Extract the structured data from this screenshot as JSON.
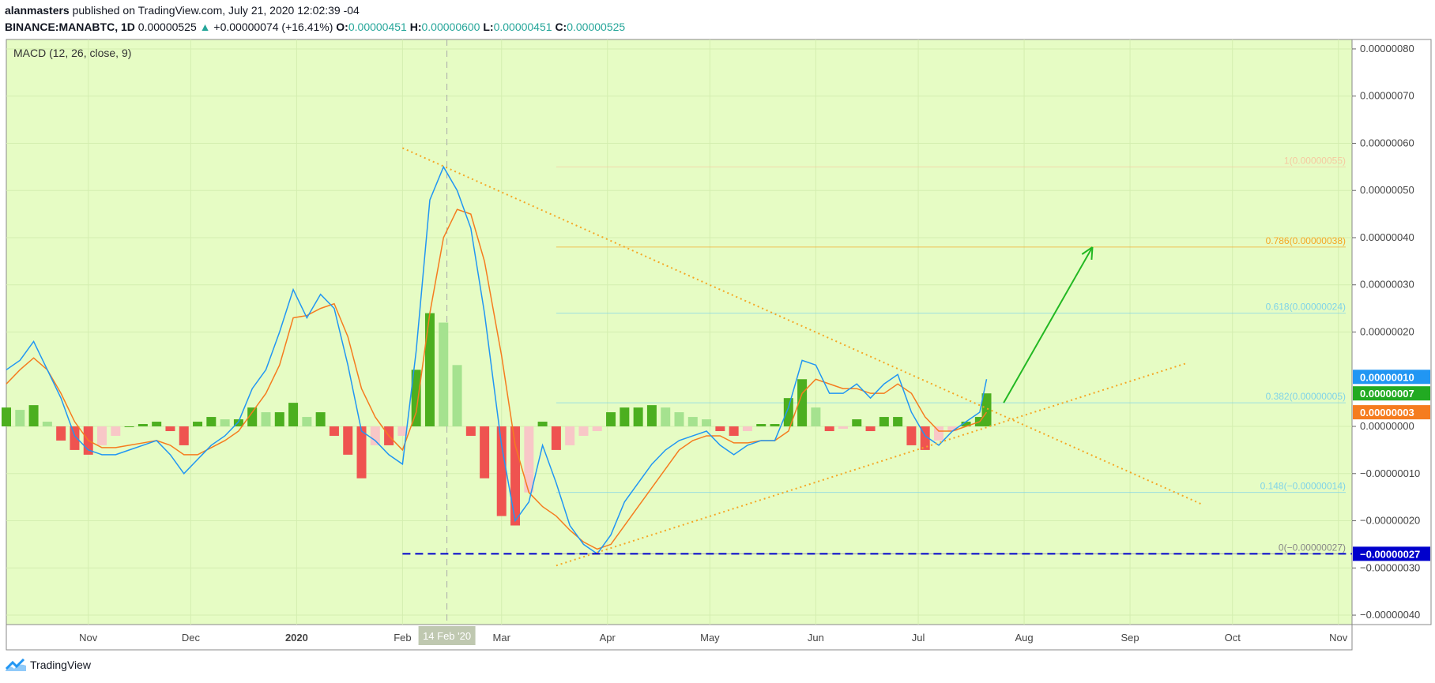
{
  "header": {
    "author": "alanmasters",
    "published": " published on TradingView.com, July 21, 2020 12:02:39 -04",
    "symbol": "BINANCE:MANABTC, 1D",
    "last": "0.00000525",
    "arrow": "▲",
    "change": "+0.00000074 (+16.41%)",
    "o_label": "O:",
    "o": "0.00000451",
    "h_label": "H:",
    "h": "0.00000600",
    "l_label": "L:",
    "l": "0.00000451",
    "c_label": "C:",
    "c": "0.00000525"
  },
  "footer": {
    "brand": "TradingView"
  },
  "chart_data": {
    "type": "line",
    "title": "MACD (12, 26, close, 9)",
    "background": "#e6fcc4",
    "ylim": [
      -4.2e-07,
      8.2e-07
    ],
    "y_ticks": [
      {
        "v": 8e-07,
        "label": "0.00000080"
      },
      {
        "v": 7e-07,
        "label": "0.00000070"
      },
      {
        "v": 6e-07,
        "label": "0.00000060"
      },
      {
        "v": 5e-07,
        "label": "0.00000050"
      },
      {
        "v": 4e-07,
        "label": "0.00000040"
      },
      {
        "v": 3e-07,
        "label": "0.00000030"
      },
      {
        "v": 2e-07,
        "label": "0.00000020"
      },
      {
        "v": 0.0,
        "label": "0.00000000"
      },
      {
        "v": -1e-07,
        "label": "−0.00000010"
      },
      {
        "v": -2e-07,
        "label": "−0.00000020"
      },
      {
        "v": -3e-07,
        "label": "−0.00000030"
      },
      {
        "v": -4e-07,
        "label": "−0.00000040"
      }
    ],
    "x_range": [
      "2019-10-08",
      "2020-11-05"
    ],
    "x_ticks": [
      {
        "date": "2019-11-01",
        "label": "Nov",
        "bold": false
      },
      {
        "date": "2019-12-01",
        "label": "Dec",
        "bold": false
      },
      {
        "date": "2020-01-01",
        "label": "2020",
        "bold": true
      },
      {
        "date": "2020-02-01",
        "label": "Feb",
        "bold": false
      },
      {
        "date": "2020-03-01",
        "label": "Mar",
        "bold": false
      },
      {
        "date": "2020-04-01",
        "label": "Apr",
        "bold": false
      },
      {
        "date": "2020-05-01",
        "label": "May",
        "bold": false
      },
      {
        "date": "2020-06-01",
        "label": "Jun",
        "bold": false
      },
      {
        "date": "2020-07-01",
        "label": "Jul",
        "bold": false
      },
      {
        "date": "2020-08-01",
        "label": "Aug",
        "bold": false
      },
      {
        "date": "2020-09-01",
        "label": "Sep",
        "bold": false
      },
      {
        "date": "2020-10-01",
        "label": "Oct",
        "bold": false
      },
      {
        "date": "2020-11-01",
        "label": "Nov",
        "bold": false
      }
    ],
    "crosshair": {
      "date": "2020-02-14",
      "label": "14 Feb '20"
    },
    "colors": {
      "macd": "#2196f3",
      "signal": "#f57c1f",
      "hist_up_strong": "#4caf1f",
      "hist_up_weak": "#a5e28f",
      "hist_down_strong": "#ef5350",
      "hist_down_weak": "#f8c7c7",
      "trendline": "#f5a623",
      "arrow": "#22b822",
      "support": "#0000cc"
    },
    "series": [
      {
        "name": "MACD",
        "points": [
          [
            "2019-10-08",
            1.2e-07
          ],
          [
            "2019-10-12",
            1.4e-07
          ],
          [
            "2019-10-16",
            1.8e-07
          ],
          [
            "2019-10-20",
            1.2e-07
          ],
          [
            "2019-10-24",
            6e-08
          ],
          [
            "2019-10-28",
            -2e-08
          ],
          [
            "2019-11-01",
            -5e-08
          ],
          [
            "2019-11-05",
            -6e-08
          ],
          [
            "2019-11-09",
            -6e-08
          ],
          [
            "2019-11-13",
            -5e-08
          ],
          [
            "2019-11-17",
            -4e-08
          ],
          [
            "2019-11-21",
            -3e-08
          ],
          [
            "2019-11-25",
            -6e-08
          ],
          [
            "2019-11-29",
            -1e-07
          ],
          [
            "2019-12-03",
            -7e-08
          ],
          [
            "2019-12-07",
            -4e-08
          ],
          [
            "2019-12-11",
            -2e-08
          ],
          [
            "2019-12-15",
            1e-08
          ],
          [
            "2019-12-19",
            8e-08
          ],
          [
            "2019-12-23",
            1.2e-07
          ],
          [
            "2019-12-27",
            2e-07
          ],
          [
            "2019-12-31",
            2.9e-07
          ],
          [
            "2020-01-04",
            2.3e-07
          ],
          [
            "2020-01-08",
            2.8e-07
          ],
          [
            "2020-01-12",
            2.5e-07
          ],
          [
            "2020-01-16",
            1.3e-07
          ],
          [
            "2020-01-20",
            -1e-08
          ],
          [
            "2020-01-24",
            -3e-08
          ],
          [
            "2020-01-28",
            -6e-08
          ],
          [
            "2020-02-01",
            -8e-08
          ],
          [
            "2020-02-05",
            1.6e-07
          ],
          [
            "2020-02-09",
            4.8e-07
          ],
          [
            "2020-02-13",
            5.5e-07
          ],
          [
            "2020-02-17",
            5e-07
          ],
          [
            "2020-02-21",
            4.2e-07
          ],
          [
            "2020-02-25",
            2.4e-07
          ],
          [
            "2020-03-01",
            -4e-08
          ],
          [
            "2020-03-05",
            -2e-07
          ],
          [
            "2020-03-09",
            -1.6e-07
          ],
          [
            "2020-03-13",
            -4e-08
          ],
          [
            "2020-03-17",
            -1.2e-07
          ],
          [
            "2020-03-21",
            -2.1e-07
          ],
          [
            "2020-03-25",
            -2.5e-07
          ],
          [
            "2020-03-29",
            -2.7e-07
          ],
          [
            "2020-04-02",
            -2.3e-07
          ],
          [
            "2020-04-06",
            -1.6e-07
          ],
          [
            "2020-04-10",
            -1.2e-07
          ],
          [
            "2020-04-14",
            -8e-08
          ],
          [
            "2020-04-18",
            -5e-08
          ],
          [
            "2020-04-22",
            -3e-08
          ],
          [
            "2020-04-26",
            -2e-08
          ],
          [
            "2020-04-30",
            -1e-08
          ],
          [
            "2020-05-04",
            -4e-08
          ],
          [
            "2020-05-08",
            -6e-08
          ],
          [
            "2020-05-12",
            -4e-08
          ],
          [
            "2020-05-16",
            -3e-08
          ],
          [
            "2020-05-20",
            -3e-08
          ],
          [
            "2020-05-24",
            4e-08
          ],
          [
            "2020-05-28",
            1.4e-07
          ],
          [
            "2020-06-01",
            1.3e-07
          ],
          [
            "2020-06-05",
            7e-08
          ],
          [
            "2020-06-09",
            7e-08
          ],
          [
            "2020-06-13",
            9e-08
          ],
          [
            "2020-06-17",
            6e-08
          ],
          [
            "2020-06-21",
            9e-08
          ],
          [
            "2020-06-25",
            1.1e-07
          ],
          [
            "2020-06-29",
            3e-08
          ],
          [
            "2020-07-03",
            -2e-08
          ],
          [
            "2020-07-07",
            -4e-08
          ],
          [
            "2020-07-11",
            -1e-08
          ],
          [
            "2020-07-15",
            1e-08
          ],
          [
            "2020-07-19",
            3e-08
          ],
          [
            "2020-07-21",
            1e-07
          ]
        ]
      },
      {
        "name": "Signal",
        "points": [
          [
            "2019-10-08",
            9e-08
          ],
          [
            "2019-10-12",
            1.2e-07
          ],
          [
            "2019-10-16",
            1.45e-07
          ],
          [
            "2019-10-20",
            1.2e-07
          ],
          [
            "2019-10-24",
            7e-08
          ],
          [
            "2019-10-28",
            1e-08
          ],
          [
            "2019-11-01",
            -3e-08
          ],
          [
            "2019-11-05",
            -4.5e-08
          ],
          [
            "2019-11-09",
            -4.5e-08
          ],
          [
            "2019-11-13",
            -4e-08
          ],
          [
            "2019-11-17",
            -3.5e-08
          ],
          [
            "2019-11-21",
            -3e-08
          ],
          [
            "2019-11-25",
            -4e-08
          ],
          [
            "2019-11-29",
            -6e-08
          ],
          [
            "2019-12-03",
            -6e-08
          ],
          [
            "2019-12-07",
            -4.5e-08
          ],
          [
            "2019-12-11",
            -3e-08
          ],
          [
            "2019-12-15",
            -1e-08
          ],
          [
            "2019-12-19",
            3e-08
          ],
          [
            "2019-12-23",
            7e-08
          ],
          [
            "2019-12-27",
            1.3e-07
          ],
          [
            "2019-12-31",
            2.3e-07
          ],
          [
            "2020-01-04",
            2.35e-07
          ],
          [
            "2020-01-08",
            2.5e-07
          ],
          [
            "2020-01-12",
            2.6e-07
          ],
          [
            "2020-01-16",
            1.9e-07
          ],
          [
            "2020-01-20",
            8e-08
          ],
          [
            "2020-01-24",
            2e-08
          ],
          [
            "2020-01-28",
            -2e-08
          ],
          [
            "2020-02-01",
            -5e-08
          ],
          [
            "2020-02-05",
            3e-08
          ],
          [
            "2020-02-09",
            2.4e-07
          ],
          [
            "2020-02-13",
            4e-07
          ],
          [
            "2020-02-17",
            4.6e-07
          ],
          [
            "2020-02-21",
            4.5e-07
          ],
          [
            "2020-02-25",
            3.5e-07
          ],
          [
            "2020-03-01",
            1.5e-07
          ],
          [
            "2020-03-05",
            -4e-08
          ],
          [
            "2020-03-09",
            -1.4e-07
          ],
          [
            "2020-03-13",
            -1.7e-07
          ],
          [
            "2020-03-17",
            -1.9e-07
          ],
          [
            "2020-03-21",
            -2.2e-07
          ],
          [
            "2020-03-25",
            -2.45e-07
          ],
          [
            "2020-03-29",
            -2.6e-07
          ],
          [
            "2020-04-02",
            -2.5e-07
          ],
          [
            "2020-04-06",
            -2.1e-07
          ],
          [
            "2020-04-10",
            -1.7e-07
          ],
          [
            "2020-04-14",
            -1.3e-07
          ],
          [
            "2020-04-18",
            -9e-08
          ],
          [
            "2020-04-22",
            -5e-08
          ],
          [
            "2020-04-26",
            -3e-08
          ],
          [
            "2020-04-30",
            -2e-08
          ],
          [
            "2020-05-04",
            -2e-08
          ],
          [
            "2020-05-08",
            -3.5e-08
          ],
          [
            "2020-05-12",
            -3.5e-08
          ],
          [
            "2020-05-16",
            -3e-08
          ],
          [
            "2020-05-20",
            -3e-08
          ],
          [
            "2020-05-24",
            -1e-08
          ],
          [
            "2020-05-28",
            7e-08
          ],
          [
            "2020-06-01",
            1e-07
          ],
          [
            "2020-06-05",
            9e-08
          ],
          [
            "2020-06-09",
            8e-08
          ],
          [
            "2020-06-13",
            8e-08
          ],
          [
            "2020-06-17",
            7e-08
          ],
          [
            "2020-06-21",
            7e-08
          ],
          [
            "2020-06-25",
            9e-08
          ],
          [
            "2020-06-29",
            7e-08
          ],
          [
            "2020-07-03",
            2e-08
          ],
          [
            "2020-07-07",
            -1e-08
          ],
          [
            "2020-07-11",
            -1e-08
          ],
          [
            "2020-07-15",
            0
          ],
          [
            "2020-07-19",
            1e-08
          ],
          [
            "2020-07-21",
            3e-08
          ]
        ]
      }
    ],
    "histogram": [
      [
        "2019-10-08",
        4e-08
      ],
      [
        "2019-10-12",
        3.5e-08
      ],
      [
        "2019-10-16",
        4.5e-08
      ],
      [
        "2019-10-20",
        1e-08
      ],
      [
        "2019-10-24",
        -3e-08
      ],
      [
        "2019-10-28",
        -5e-08
      ],
      [
        "2019-11-01",
        -6e-08
      ],
      [
        "2019-11-05",
        -4e-08
      ],
      [
        "2019-11-09",
        -2e-08
      ],
      [
        "2019-11-13",
        0
      ],
      [
        "2019-11-17",
        5e-09
      ],
      [
        "2019-11-21",
        1e-08
      ],
      [
        "2019-11-25",
        -1e-08
      ],
      [
        "2019-11-29",
        -4e-08
      ],
      [
        "2019-12-03",
        1e-08
      ],
      [
        "2019-12-07",
        2e-08
      ],
      [
        "2019-12-11",
        1.5e-08
      ],
      [
        "2019-12-15",
        1.5e-08
      ],
      [
        "2019-12-19",
        4e-08
      ],
      [
        "2019-12-23",
        3e-08
      ],
      [
        "2019-12-27",
        3e-08
      ],
      [
        "2019-12-31",
        5e-08
      ],
      [
        "2020-01-04",
        2e-08
      ],
      [
        "2020-01-08",
        3e-08
      ],
      [
        "2020-01-12",
        -2e-08
      ],
      [
        "2020-01-16",
        -6e-08
      ],
      [
        "2020-01-20",
        -1.1e-07
      ],
      [
        "2020-01-24",
        -4e-08
      ],
      [
        "2020-01-28",
        -4e-08
      ],
      [
        "2020-02-01",
        -2e-08
      ],
      [
        "2020-02-05",
        1.2e-07
      ],
      [
        "2020-02-09",
        2.4e-07
      ],
      [
        "2020-02-13",
        2.2e-07
      ],
      [
        "2020-02-17",
        1.3e-07
      ],
      [
        "2020-02-21",
        -2e-08
      ],
      [
        "2020-02-25",
        -1.1e-07
      ],
      [
        "2020-03-01",
        -1.9e-07
      ],
      [
        "2020-03-05",
        -2.1e-07
      ],
      [
        "2020-03-09",
        -1.4e-07
      ],
      [
        "2020-03-13",
        1e-08
      ],
      [
        "2020-03-17",
        -5e-08
      ],
      [
        "2020-03-21",
        -4e-08
      ],
      [
        "2020-03-25",
        -2e-08
      ],
      [
        "2020-03-29",
        -1e-08
      ],
      [
        "2020-04-02",
        3e-08
      ],
      [
        "2020-04-06",
        4e-08
      ],
      [
        "2020-04-10",
        4e-08
      ],
      [
        "2020-04-14",
        4.5e-08
      ],
      [
        "2020-04-18",
        4e-08
      ],
      [
        "2020-04-22",
        3e-08
      ],
      [
        "2020-04-26",
        2e-08
      ],
      [
        "2020-04-30",
        1.5e-08
      ],
      [
        "2020-05-04",
        -1e-08
      ],
      [
        "2020-05-08",
        -2e-08
      ],
      [
        "2020-05-12",
        -1e-08
      ],
      [
        "2020-05-16",
        5e-09
      ],
      [
        "2020-05-20",
        5e-09
      ],
      [
        "2020-05-24",
        6e-08
      ],
      [
        "2020-05-28",
        1e-07
      ],
      [
        "2020-06-01",
        4e-08
      ],
      [
        "2020-06-05",
        -1e-08
      ],
      [
        "2020-06-09",
        -5e-09
      ],
      [
        "2020-06-13",
        1.5e-08
      ],
      [
        "2020-06-17",
        -1e-08
      ],
      [
        "2020-06-21",
        2e-08
      ],
      [
        "2020-06-25",
        2e-08
      ],
      [
        "2020-06-29",
        -4e-08
      ],
      [
        "2020-07-03",
        -5e-08
      ],
      [
        "2020-07-07",
        -3e-08
      ],
      [
        "2020-07-11",
        -1e-08
      ],
      [
        "2020-07-15",
        1e-08
      ],
      [
        "2020-07-19",
        2e-08
      ],
      [
        "2020-07-21",
        7e-08
      ]
    ],
    "fib_levels": [
      {
        "v": 5.5e-07,
        "label": "1(0.00000055)",
        "color": "#f5c9a0"
      },
      {
        "v": 3.8e-07,
        "label": "0.786(0.00000038)",
        "color": "#f5a623"
      },
      {
        "v": 2.4e-07,
        "label": "0.618(0.00000024)",
        "color": "#7fd3e8"
      },
      {
        "v": 5e-08,
        "label": "0.382(0.00000005)",
        "color": "#7fd3e8"
      },
      {
        "v": -1.4e-07,
        "label": "0.148(−0.00000014)",
        "color": "#7fd3e8"
      },
      {
        "v": -2.7e-07,
        "label": "0(−0.00000027)",
        "color": "#888888"
      }
    ],
    "fib_start_date": "2020-03-17",
    "trendlines": [
      {
        "from": [
          "2020-02-01",
          5.9e-07
        ],
        "to": [
          "2020-09-22",
          -1.65e-07
        ]
      },
      {
        "from": [
          "2020-03-17",
          -2.95e-07
        ],
        "to": [
          "2020-09-18",
          1.35e-07
        ]
      }
    ],
    "support_line": {
      "from": "2020-02-01",
      "v": -2.7e-07
    },
    "arrow": {
      "from": [
        "2020-07-26",
        5e-08
      ],
      "to": [
        "2020-08-21",
        3.8e-07
      ]
    },
    "price_labels": [
      {
        "v": 1.05e-07,
        "label": "0.00000010",
        "color": "#2196f3"
      },
      {
        "v": 7e-08,
        "label": "0.00000007",
        "color": "#22aa22"
      },
      {
        "v": 3e-08,
        "label": "0.00000003",
        "color": "#f57c1f"
      },
      {
        "v": -2.7e-07,
        "label": "−0.00000027",
        "color": "#0000cc"
      }
    ]
  }
}
